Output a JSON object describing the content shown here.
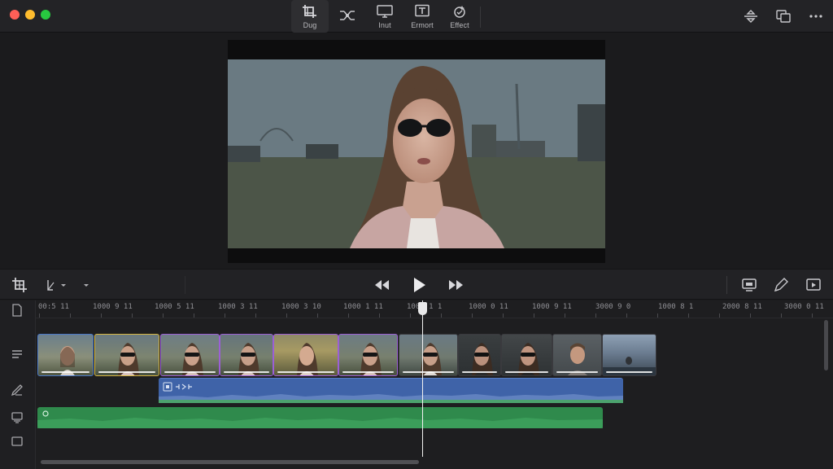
{
  "toolbar": {
    "tools": [
      {
        "id": "crop",
        "label": "Dug",
        "icon": "crop-icon",
        "active": true
      },
      {
        "id": "transform",
        "label": "",
        "icon": "transform-icon",
        "active": false
      },
      {
        "id": "input",
        "label": "Inut",
        "icon": "monitor-icon",
        "active": false
      },
      {
        "id": "export",
        "label": "Ermort",
        "icon": "text-box-icon",
        "active": false
      },
      {
        "id": "effect",
        "label": "Effect",
        "icon": "effect-sparkle-icon",
        "active": false
      }
    ],
    "right_icons": [
      "swap-arrows-icon",
      "duplicate-icon",
      "more-icon"
    ]
  },
  "viewer": {
    "description_icon": "video-preview"
  },
  "transport": {
    "left_icons": [
      "crop-icon",
      "blade-tool-icon",
      "chevron-down-icon"
    ],
    "controls": [
      "rewind-icon",
      "play-icon",
      "fast-forward-icon"
    ],
    "right_icons": [
      "screen-icon",
      "pen-icon",
      "preview-window-icon"
    ]
  },
  "timeline": {
    "ruler_labels": [
      "00:5 11",
      "1000 9 11",
      "1000 5 11",
      "1000 3 11",
      "1000 3 10",
      "1000 1 11",
      "1008 1 1",
      "1000 0 11",
      "1000 9 11",
      "3000 9 0",
      "1000 8 1",
      "2000 8 11",
      "3000 0 11"
    ],
    "clips": [
      {
        "color": "#4a78c8",
        "tone": "warm"
      },
      {
        "color": "#d7b640",
        "tone": "dusk"
      },
      {
        "color": "#9c5fd6",
        "tone": "field"
      },
      {
        "color": "#9c5fd6",
        "tone": "field"
      },
      {
        "color": "#9c5fd6",
        "tone": "sunset"
      },
      {
        "color": "#9c5fd6",
        "tone": "field"
      },
      {
        "color": "#3b3b3f",
        "tone": "cool"
      },
      {
        "color": "#3b3b3f",
        "tone": "dark"
      },
      {
        "color": "#3b3b3f",
        "tone": "dark"
      },
      {
        "color": "#3b3b3f",
        "tone": "grey"
      },
      {
        "color": "#3b3b3f",
        "tone": "sky"
      }
    ],
    "audio_clip_icon": "audio-clip-icon",
    "sidebar_icons": [
      "document-icon",
      "subtitles-icon",
      "pen-track-icon",
      "stack-icon",
      "box-icon"
    ]
  },
  "colors": {
    "accent_blue": "#3f63a8",
    "audio_green": "#2f8a4c",
    "purple_clip": "#9c5fd6",
    "yellow_clip": "#d7b640"
  }
}
